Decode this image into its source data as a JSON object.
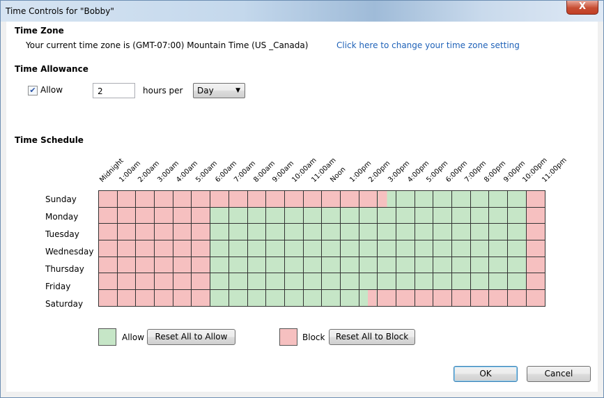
{
  "window": {
    "title": "Time Controls for \"Bobby\"",
    "close_label": "X"
  },
  "time_zone": {
    "heading": "Time Zone",
    "current_text": "Your current time zone is (GMT-07:00) Mountain Time (US _Canada)",
    "change_link": "Click here to change your time zone setting"
  },
  "allowance": {
    "heading": "Time Allowance",
    "allow_checked": true,
    "allow_label": "Allow",
    "hours_value": "2",
    "hours_per_label": "hours per",
    "period_selected": "Day"
  },
  "schedule": {
    "heading": "Time Schedule",
    "hours": [
      "Midnight",
      "1:00am",
      "2:00am",
      "3:00am",
      "4:00am",
      "5:00am",
      "6:00am",
      "7:00am",
      "8:00am",
      "9:00am",
      "10:00am",
      "11:00am",
      "Noon",
      "1:00pm",
      "2:00pm",
      "3:00pm",
      "4:00pm",
      "5:00pm",
      "6:00pm",
      "7:00pm",
      "8:00pm",
      "9:00pm",
      "10:00pm",
      "11:00pm"
    ],
    "days": [
      {
        "name": "Sunday",
        "cells": "BBBBBBBBBBBBBBBHAAAAAAAB"
      },
      {
        "name": "Monday",
        "cells": "BBBBBBAAAAAAAAAAAAAAAAAB"
      },
      {
        "name": "Tuesday",
        "cells": "BBBBBBAAAAAAAAAAAAAAAAAB"
      },
      {
        "name": "Wednesday",
        "cells": "BBBBBBAAAAAAAAAAAAAAAAAB"
      },
      {
        "name": "Thursday",
        "cells": "BBBBBBAAAAAAAAAAAAAAAAAB"
      },
      {
        "name": "Friday",
        "cells": "BBBBBBAAAAAAAAAAAAAAAAAB"
      },
      {
        "name": "Saturday",
        "cells": "BBBBBBAAAAAAAAKBBBBBBBBB"
      }
    ],
    "colors": {
      "allow": "#c6e6c7",
      "block": "#f6c0c0"
    }
  },
  "legend": {
    "allow_label": "Allow",
    "reset_allow_button": "Reset All to Allow",
    "block_label": "Block",
    "reset_block_button": "Reset All to Block"
  },
  "footer": {
    "ok_button": "OK",
    "cancel_button": "Cancel"
  }
}
